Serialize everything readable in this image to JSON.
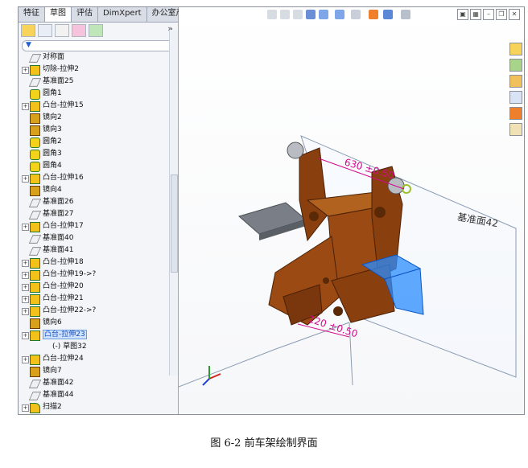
{
  "tabs": [
    "特征",
    "草图",
    "评估",
    "DimXpert",
    "办公室产品"
  ],
  "active_tab": "草图",
  "manager": {
    "chevron": "»"
  },
  "tree": [
    {
      "label": "对称面",
      "icon": "plane",
      "expand": false
    },
    {
      "label": "切除-拉伸2",
      "icon": "extrude",
      "expand": true
    },
    {
      "label": "基准面25",
      "icon": "plane",
      "expand": false
    },
    {
      "label": "圆角1",
      "icon": "fillet",
      "expand": false
    },
    {
      "label": "凸台-拉伸15",
      "icon": "extrude",
      "expand": true
    },
    {
      "label": "镜向2",
      "icon": "mirror",
      "expand": false
    },
    {
      "label": "镜向3",
      "icon": "mirror",
      "expand": false
    },
    {
      "label": "圆角2",
      "icon": "fillet",
      "expand": false
    },
    {
      "label": "圆角3",
      "icon": "fillet",
      "expand": false
    },
    {
      "label": "圆角4",
      "icon": "fillet",
      "expand": false
    },
    {
      "label": "凸台-拉伸16",
      "icon": "extrude",
      "expand": true
    },
    {
      "label": "镜向4",
      "icon": "mirror",
      "expand": false
    },
    {
      "label": "基准面26",
      "icon": "plane",
      "expand": false
    },
    {
      "label": "基准面27",
      "icon": "plane",
      "expand": false
    },
    {
      "label": "凸台-拉伸17",
      "icon": "extrude",
      "expand": true
    },
    {
      "label": "基准面40",
      "icon": "plane",
      "expand": false
    },
    {
      "label": "基准面41",
      "icon": "plane",
      "expand": false
    },
    {
      "label": "凸台-拉伸18",
      "icon": "extrude",
      "expand": true
    },
    {
      "label": "凸台-拉伸19->?",
      "icon": "extrude",
      "expand": true
    },
    {
      "label": "凸台-拉伸20",
      "icon": "extrude",
      "expand": true
    },
    {
      "label": "凸台-拉伸21",
      "icon": "extrude",
      "expand": true
    },
    {
      "label": "凸台-拉伸22->?",
      "icon": "extrude",
      "expand": true
    },
    {
      "label": "镜向6",
      "icon": "mirror",
      "expand": false
    },
    {
      "label": "凸台-拉伸23",
      "icon": "extrude",
      "expand": true,
      "selected": true
    },
    {
      "label": "(-) 草图32",
      "icon": "sketch",
      "expand": false,
      "indent": true
    },
    {
      "label": "凸台-拉伸24",
      "icon": "extrude",
      "expand": true
    },
    {
      "label": "镜向7",
      "icon": "mirror",
      "expand": false
    },
    {
      "label": "基准面42",
      "icon": "plane",
      "expand": false
    },
    {
      "label": "基准面44",
      "icon": "plane",
      "expand": false
    },
    {
      "label": "扫描2",
      "icon": "sweep",
      "expand": true
    }
  ],
  "viewport": {
    "dimension_top": "630 ±0.50",
    "dimension_bottom": "120 ±0.50",
    "plane_label": "基准面42"
  },
  "caption": "图 6-2  前车架绘制界面",
  "colors": {
    "part": "#9a4a12",
    "dimension": "#d40a8c",
    "selection": "#2b8cff"
  }
}
